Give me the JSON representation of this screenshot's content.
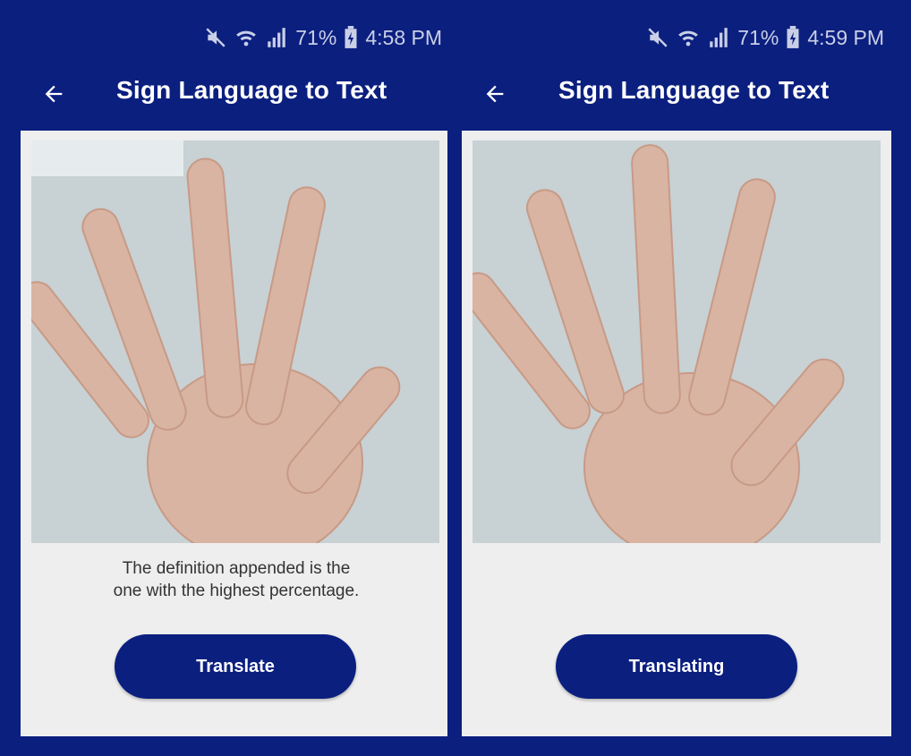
{
  "screens": [
    {
      "status": {
        "battery": "71%",
        "time": "4:58 PM"
      },
      "appbar": {
        "title": "Sign Language to Text"
      },
      "definition_text": "The definition appended is the one with the highest percentage.",
      "action_label": "Translate"
    },
    {
      "status": {
        "battery": "71%",
        "time": "4:59 PM"
      },
      "appbar": {
        "title": "Sign Language to Text"
      },
      "action_label": "Translating"
    }
  ],
  "icons": {
    "mute": "mute-icon",
    "wifi": "wifi-icon",
    "signal": "signal-icon",
    "battery": "battery-charging-icon",
    "back": "arrow-back-icon"
  },
  "colors": {
    "primary": "#0b1f7f",
    "card": "#eeeeee",
    "text": "#333333"
  }
}
